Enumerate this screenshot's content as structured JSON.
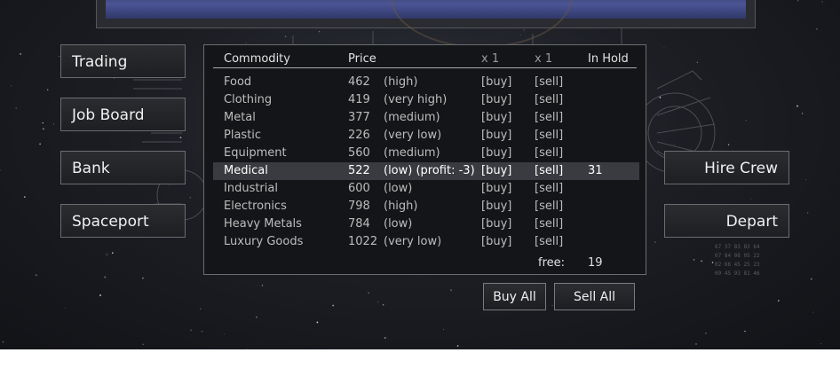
{
  "nav": {
    "trading": "Trading",
    "job_board": "Job Board",
    "bank": "Bank",
    "spaceport": "Spaceport",
    "hire_crew": "Hire Crew",
    "depart": "Depart"
  },
  "table": {
    "headers": {
      "commodity": "Commodity",
      "price": "Price",
      "buy_qty": "x 1",
      "sell_qty": "x 1",
      "in_hold": "In Hold"
    },
    "rows": [
      {
        "name": "Food",
        "price": "462",
        "note": "(high)",
        "buy": "[buy]",
        "sell": "[sell]",
        "hold": ""
      },
      {
        "name": "Clothing",
        "price": "419",
        "note": "(very high)",
        "buy": "[buy]",
        "sell": "[sell]",
        "hold": ""
      },
      {
        "name": "Metal",
        "price": "377",
        "note": "(medium)",
        "buy": "[buy]",
        "sell": "[sell]",
        "hold": ""
      },
      {
        "name": "Plastic",
        "price": "226",
        "note": "(very low)",
        "buy": "[buy]",
        "sell": "[sell]",
        "hold": ""
      },
      {
        "name": "Equipment",
        "price": "560",
        "note": "(medium)",
        "buy": "[buy]",
        "sell": "[sell]",
        "hold": ""
      },
      {
        "name": "Medical",
        "price": "522",
        "note": "(low) (profit: -3)",
        "buy": "[buy]",
        "sell": "[sell]",
        "hold": "31"
      },
      {
        "name": "Industrial",
        "price": "600",
        "note": "(low)",
        "buy": "[buy]",
        "sell": "[sell]",
        "hold": ""
      },
      {
        "name": "Electronics",
        "price": "798",
        "note": "(high)",
        "buy": "[buy]",
        "sell": "[sell]",
        "hold": ""
      },
      {
        "name": "Heavy Metals",
        "price": "784",
        "note": "(low)",
        "buy": "[buy]",
        "sell": "[sell]",
        "hold": ""
      },
      {
        "name": "Luxury Goods",
        "price": "1022",
        "note": "(very low)",
        "buy": "[buy]",
        "sell": "[sell]",
        "hold": ""
      }
    ],
    "selected_row": 5,
    "free_label": "free:",
    "free_value": "19"
  },
  "actions": {
    "buy_all": "Buy All",
    "sell_all": "Sell All"
  },
  "readout_lines": [
    "67 37 83 83 64",
    "07 84 08 05 22",
    "02 66 45 25 23",
    "09 45 93 81 46"
  ],
  "colors": {
    "panel_bg": "#141518",
    "border": "#6b6c70",
    "selected_row": "#3a3b40",
    "planet": "#4b5596"
  }
}
